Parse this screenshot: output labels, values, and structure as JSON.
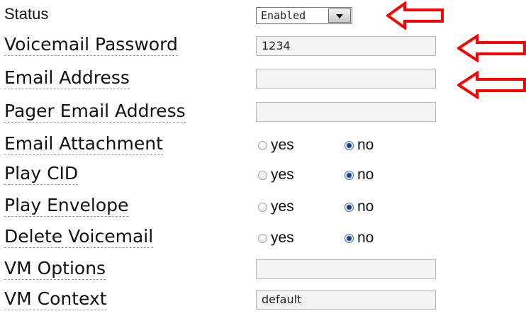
{
  "form": {
    "status": {
      "label": "Status",
      "value": "Enabled"
    },
    "voicemail_password": {
      "label": "Voicemail Password",
      "value": "1234"
    },
    "email_address": {
      "label": "Email Address",
      "value": ""
    },
    "pager_email_address": {
      "label": "Pager Email Address",
      "value": ""
    },
    "email_attachment": {
      "label": "Email Attachment",
      "yes": "yes",
      "no": "no",
      "selected": "no"
    },
    "play_cid": {
      "label": "Play CID",
      "yes": "yes",
      "no": "no",
      "selected": "no"
    },
    "play_envelope": {
      "label": "Play Envelope",
      "yes": "yes",
      "no": "no",
      "selected": "no"
    },
    "delete_voicemail": {
      "label": "Delete Voicemail",
      "yes": "yes",
      "no": "no",
      "selected": "no"
    },
    "vm_options": {
      "label": "VM Options",
      "value": ""
    },
    "vm_context": {
      "label": "VM Context",
      "value": "default"
    }
  },
  "annotations": {
    "arrow_color": "#ff0000",
    "icons": [
      "left-arrow-icon",
      "left-arrow-icon",
      "left-arrow-icon"
    ]
  }
}
